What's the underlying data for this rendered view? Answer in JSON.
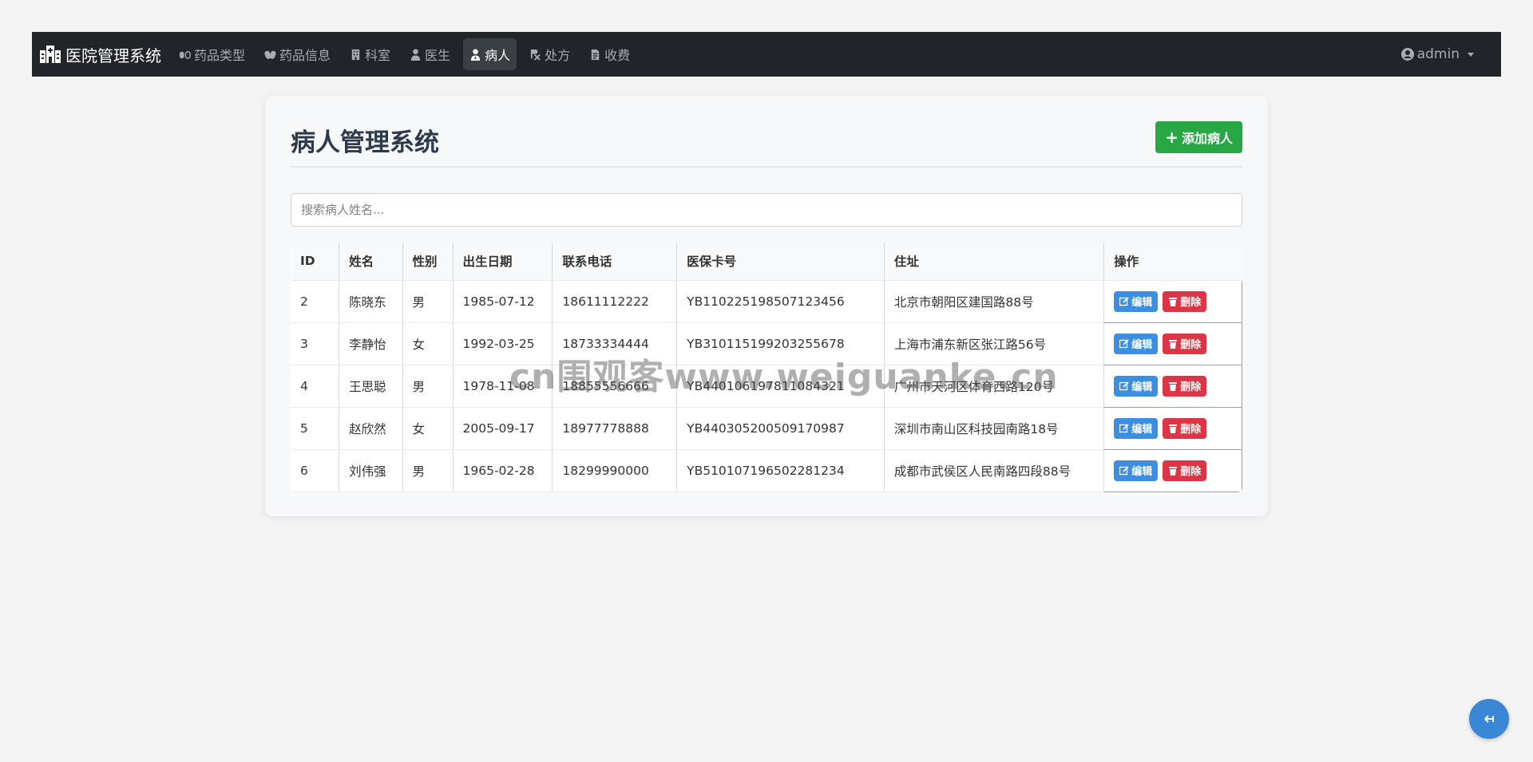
{
  "navbar": {
    "brand": "医院管理系统",
    "items": [
      {
        "label": "药品类型",
        "icon": "pills-icon"
      },
      {
        "label": "药品信息",
        "icon": "capsules-icon"
      },
      {
        "label": "科室",
        "icon": "building-icon"
      },
      {
        "label": "医生",
        "icon": "doctor-icon"
      },
      {
        "label": "病人",
        "icon": "patient-icon",
        "active": true
      },
      {
        "label": "处方",
        "icon": "prescription-icon"
      },
      {
        "label": "收费",
        "icon": "invoice-icon"
      }
    ],
    "user": "admin"
  },
  "page": {
    "title": "病人管理系统",
    "add_button": "添加病人",
    "search_placeholder": "搜索病人姓名..."
  },
  "table": {
    "headers": [
      "ID",
      "姓名",
      "性别",
      "出生日期",
      "联系电话",
      "医保卡号",
      "住址",
      "操作"
    ],
    "rows": [
      [
        "2",
        "陈晓东",
        "男",
        "1985-07-12",
        "18611112222",
        "YB110225198507123456",
        "北京市朝阳区建国路88号"
      ],
      [
        "3",
        "李静怡",
        "女",
        "1992-03-25",
        "18733334444",
        "YB310115199203255678",
        "上海市浦东新区张江路56号"
      ],
      [
        "4",
        "王思聪",
        "男",
        "1978-11-08",
        "18855556666",
        "YB440106197811084321",
        "广州市天河区体育西路120号"
      ],
      [
        "5",
        "赵欣然",
        "女",
        "2005-09-17",
        "18977778888",
        "YB440305200509170987",
        "深圳市南山区科技园南路18号"
      ],
      [
        "6",
        "刘伟强",
        "男",
        "1965-02-28",
        "18299990000",
        "YB510107196502281234",
        "成都市武侯区人民南路四段88号"
      ]
    ],
    "edit_label": "编辑",
    "delete_label": "删除"
  },
  "watermark": "cn围观客www.weiguanke.cn",
  "colors": {
    "navbar": "#212529",
    "add_button": "#28a745",
    "edit_button": "#3b8ee0",
    "delete_button": "#dc3545",
    "fab": "#3a87d6"
  }
}
